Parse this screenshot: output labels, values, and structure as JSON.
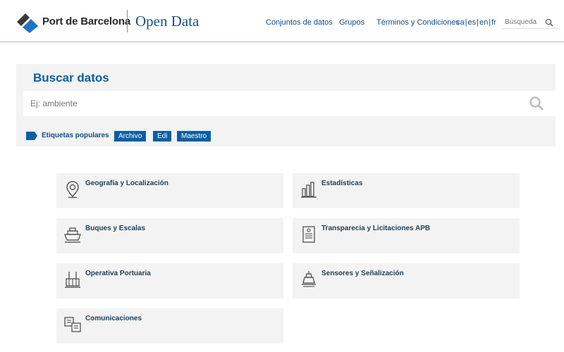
{
  "brand": {
    "name": "Port de Barcelona",
    "subtitle": "Open Data",
    "colors": {
      "primary": "#0a5fa3",
      "dark_text": "#1d3e57",
      "panel": "#f3f3f3"
    }
  },
  "nav": {
    "items": [
      {
        "label": "Conjuntos de datos"
      },
      {
        "label": "Grupos"
      },
      {
        "label": "Términos y Condiciones"
      }
    ],
    "languages": [
      "ca",
      "es",
      "en",
      "fr"
    ],
    "search": {
      "placeholder": "Búsqueda",
      "icon": "search-icon"
    }
  },
  "search_panel": {
    "title": "Buscar datos",
    "input_placeholder": "Ej: ambiente",
    "icon": "search-icon",
    "tags_label": "Etiquetas populares",
    "tags": [
      "Archivo",
      "Edi",
      "Maestro"
    ]
  },
  "categories": [
    {
      "label": "Geografía y Localización",
      "icon": "map-pin-icon"
    },
    {
      "label": "Estadísticas",
      "icon": "bar-chart-icon"
    },
    {
      "label": "Buques y Escalas",
      "icon": "ship-icon"
    },
    {
      "label": "Transparecia y Licitaciones APB",
      "icon": "document-icon"
    },
    {
      "label": "Operativa Portuaria",
      "icon": "crane-icon"
    },
    {
      "label": "Sensores y Señalización",
      "icon": "buoy-icon"
    },
    {
      "label": "Comunicaciones",
      "icon": "communications-icon"
    }
  ]
}
